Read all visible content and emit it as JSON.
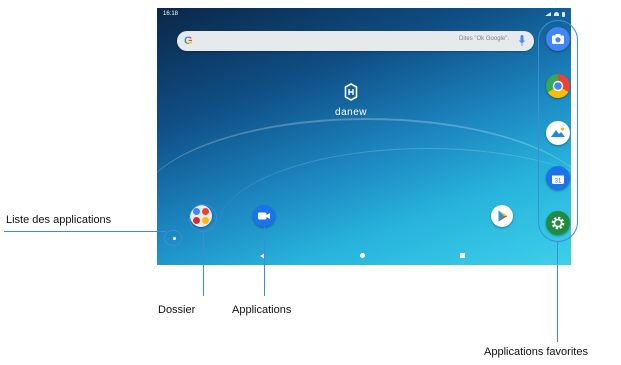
{
  "status_bar": {
    "time": "16:18"
  },
  "search": {
    "logo": "G",
    "hint": "Dites \"Ok Google\"."
  },
  "brand": {
    "name": "danew"
  },
  "favorites": [
    {
      "id": "camera",
      "icon": "camera-icon"
    },
    {
      "id": "chrome",
      "icon": "chrome-icon"
    },
    {
      "id": "gallery",
      "icon": "gallery-icon"
    },
    {
      "id": "calendar",
      "icon": "calendar-icon",
      "label": "31"
    },
    {
      "id": "settings",
      "icon": "settings-icon"
    }
  ],
  "dock": [
    {
      "id": "folder",
      "icon": "folder-icon"
    },
    {
      "id": "duo",
      "icon": "video-camera-icon"
    },
    {
      "id": "play",
      "icon": "play-store-icon"
    }
  ],
  "annotations": {
    "app_list": "Liste des applications",
    "folder": "Dossier",
    "applications": "Applications",
    "favorites": "Applications favorites"
  },
  "colors": {
    "annotation_line": "#3a8ed8",
    "favorites_bar": "#2d8fd8"
  }
}
